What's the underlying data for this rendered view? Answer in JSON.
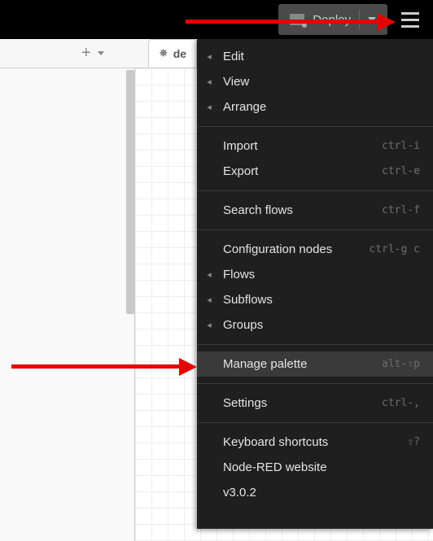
{
  "header": {
    "deploy_label": "Deploy"
  },
  "tabs": {
    "debug_label": "de"
  },
  "menu": {
    "edit": "Edit",
    "view": "View",
    "arrange": "Arrange",
    "import": "Import",
    "import_key": "ctrl-i",
    "export": "Export",
    "export_key": "ctrl-e",
    "search": "Search flows",
    "search_key": "ctrl-f",
    "config": "Configuration nodes",
    "config_key": "ctrl-g c",
    "flows": "Flows",
    "subflows": "Subflows",
    "groups": "Groups",
    "palette": "Manage palette",
    "palette_key": "alt-⇧p",
    "settings": "Settings",
    "settings_key": "ctrl-,",
    "shortcuts": "Keyboard shortcuts",
    "shortcuts_key": "⇧?",
    "website": "Node-RED website",
    "version": "v3.0.2"
  }
}
